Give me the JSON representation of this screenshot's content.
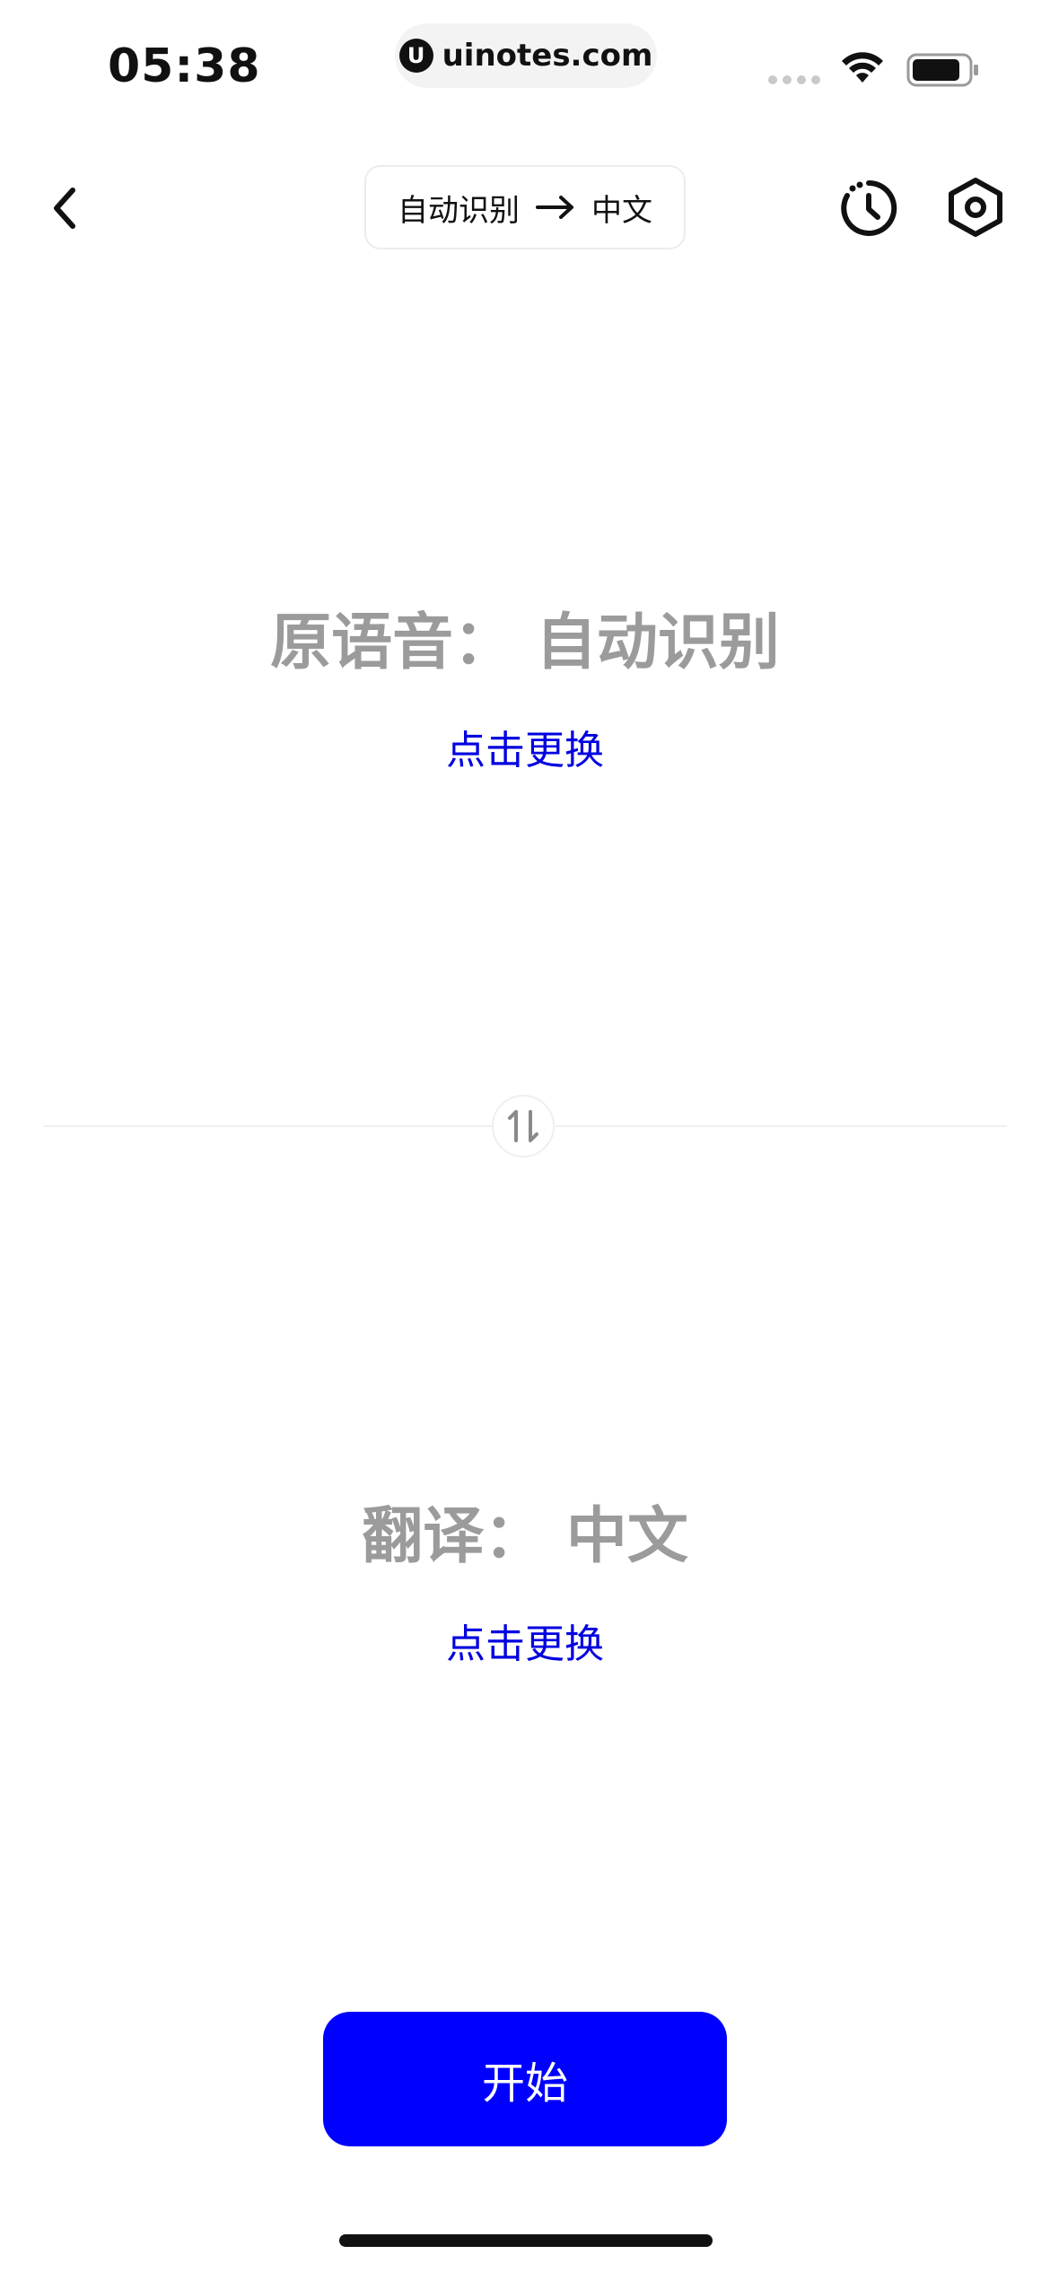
{
  "status_bar": {
    "time": "05:38",
    "url": "uinotes.com",
    "logo_glyph": "U",
    "icons": [
      "signal-dots-icon",
      "wifi-icon",
      "battery-icon"
    ]
  },
  "nav": {
    "back_icon": "chevron-left-icon",
    "source_lang": "自动识别",
    "arrow_icon": "arrow-right-icon",
    "target_lang": "中文",
    "history_icon": "history-clock-icon",
    "settings_icon": "hexagon-settings-icon"
  },
  "source": {
    "title": "原语音： 自动识别",
    "change_label": "点击更换"
  },
  "swap": {
    "icon": "swap-vertical-icon",
    "glyph": "⇅"
  },
  "target": {
    "title": "翻译： 中文",
    "change_label": "点击更换"
  },
  "actions": {
    "start_label": "开始"
  },
  "colors": {
    "accent": "#0000ff",
    "link": "#0000e0",
    "muted_text": "#9b9b9b",
    "background": "#ffffff"
  }
}
